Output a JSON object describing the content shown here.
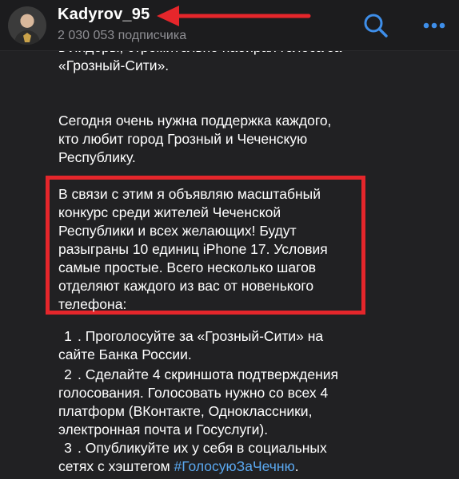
{
  "header": {
    "channel_name": "Kadyrov_95",
    "subscribers": "2 030 053 подписчика",
    "search_icon": "search-icon",
    "more_icon": "more-icon",
    "accent_color": "#3e8ee9",
    "annotation_arrow_color": "#e5262b"
  },
  "message": {
    "paragraph_1": "в лидеры, стремительно набирая голоса за\n«Грозный-Сити».",
    "paragraph_2": "Сегодня очень нужна поддержка каждого,\nкто любит город Грозный и Чеченскую\nРеспублику.",
    "paragraph_3": "В связи с этим я объявляю масштабный\nконкурс среди жителей Чеченской\nРеспублики и всех желающих! Будут\nразыграны 10 единиц iPhone 17. Условия\nсамые простые. Всего несколько шагов\nотделяют каждого из вас от новенького\nтелефона:",
    "steps": [
      {
        "number": "1",
        "text": ". Проголосуйте за «Грозный-Сити» на\nсайте Банка России."
      },
      {
        "number": "2",
        "text": ". Сделайте 4 скриншота подтверждения\nголосования. Голосовать нужно со всех 4\nплатформ (ВКонтакте, Одноклассники,\nэлектронная почта и Госуслуги)."
      },
      {
        "number": "3",
        "text": ". Опубликуйте их у себя в социальных\nсетях с хэштегом ",
        "hashtag": "#ГолосуюЗаЧечню",
        "suffix": "."
      }
    ],
    "highlight_color": "#e5262b",
    "link_color": "#5aa8f0"
  }
}
